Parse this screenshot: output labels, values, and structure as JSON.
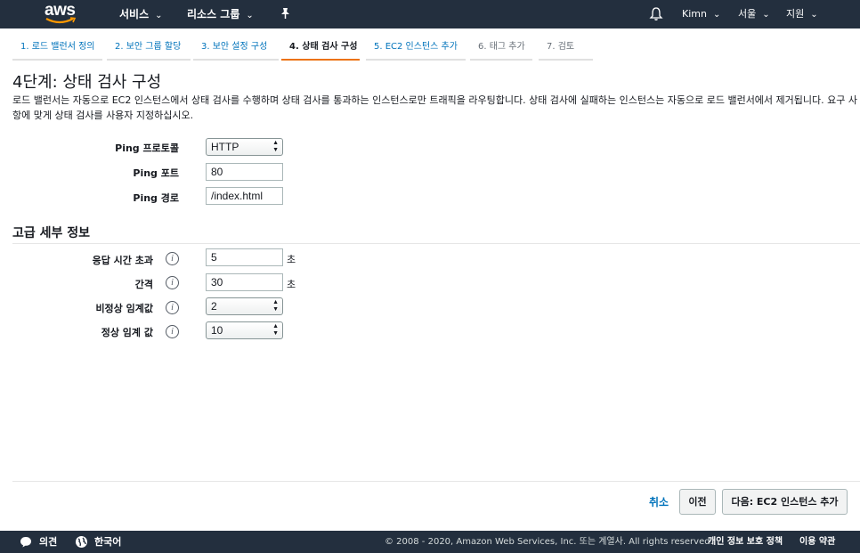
{
  "nav": {
    "logo": "aws",
    "services": "서비스",
    "resource_groups": "리소스 그룹",
    "user": "Kimn",
    "region": "서울",
    "support": "지원"
  },
  "tabs": [
    {
      "label": "1. 로드 밸런서 정의",
      "state": "link"
    },
    {
      "label": "2. 보안 그룹 할당",
      "state": "link"
    },
    {
      "label": "3. 보안 설정 구성",
      "state": "link"
    },
    {
      "label": "4. 상태 검사 구성",
      "state": "active"
    },
    {
      "label": "5. EC2 인스턴스 추가",
      "state": "link"
    },
    {
      "label": "6. 태그 추가",
      "state": "disabled"
    },
    {
      "label": "7. 검토",
      "state": "disabled"
    }
  ],
  "page": {
    "title": "4단계: 상태 검사 구성",
    "description": "로드 밸런서는 자동으로 EC2 인스턴스에서 상태 검사를 수행하며 상태 검사를 통과하는 인스턴스로만 트래픽을 라우팅합니다. 상태 검사에 실패하는 인스턴스는 자동으로 로드 밸런서에서 제거됩니다. 요구 사항에 맞게 상태 검사를 사용자 지정하십시오."
  },
  "ping": {
    "protocol_label": "Ping 프로토콜",
    "protocol_value": "HTTP",
    "port_label": "Ping 포트",
    "port_value": "80",
    "path_label": "Ping 경로",
    "path_value": "/index.html"
  },
  "advanced": {
    "title": "고급 세부 정보",
    "timeout_label": "응답 시간 초과",
    "timeout_value": "5",
    "timeout_unit": "초",
    "interval_label": "간격",
    "interval_value": "30",
    "interval_unit": "초",
    "unhealthy_label": "비정상 임계값",
    "unhealthy_value": "2",
    "healthy_label": "정상 임계 값",
    "healthy_value": "10",
    "info_glyph": "i"
  },
  "actions": {
    "cancel": "취소",
    "previous": "이전",
    "next": "다음: EC2 인스턴스 추가"
  },
  "footer": {
    "feedback": "의견",
    "language": "한국어",
    "copyright": "© 2008 - 2020, Amazon Web Services, Inc. 또는 계열사. All rights reserved.",
    "privacy": "개인 정보 보호 정책",
    "terms": "이용 약관"
  },
  "colors": {
    "nav_bg": "#232f3e",
    "link": "#0073bb",
    "active_tab_border": "#ec7211"
  }
}
